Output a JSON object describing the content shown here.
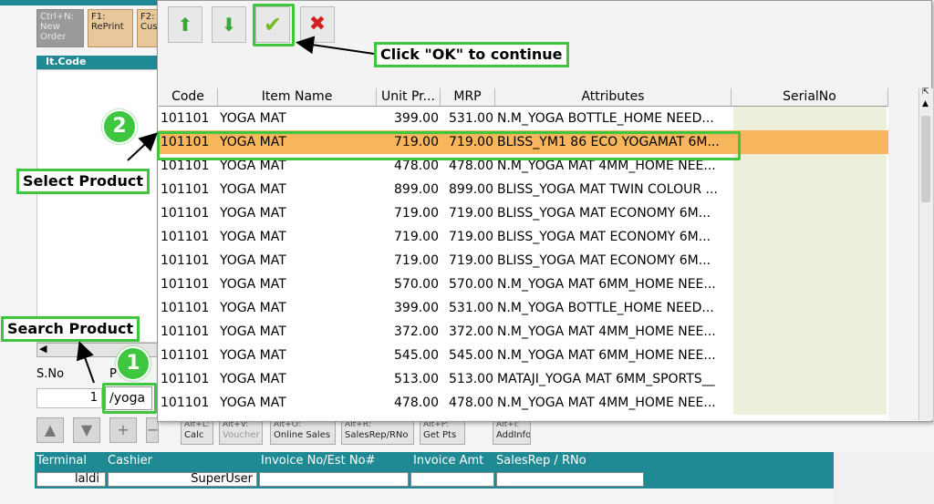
{
  "colors": {
    "teal": "#1f8a94",
    "selected_row": "#f7b55c",
    "annotation": "#3ec63e"
  },
  "background": {
    "fkeys": [
      {
        "key": "Ctrl+N:",
        "label": "New Order"
      },
      {
        "key": "F1:",
        "label": "RePrint"
      },
      {
        "key": "F2:",
        "label": "Cus"
      }
    ],
    "it_code_header": "It.Code",
    "sno_label": "S.No",
    "product_label_partial": "P",
    "sno_value": "1",
    "search_value": "/yoga",
    "bottom_keys": [
      {
        "key": "Alt+L:",
        "label": "Calc"
      },
      {
        "key": "Alt+V:",
        "label": "Voucher"
      },
      {
        "key": "Alt+O:",
        "label": "Online Sales"
      },
      {
        "key": "Alt+R:",
        "label": "SalesRep/RNo"
      },
      {
        "key": "Alt+P:",
        "label": "Get Pts"
      },
      {
        "key": "Alt+I:",
        "label": "AddInfo"
      }
    ],
    "footer_headers": [
      "Terminal",
      "Cashier",
      "Invoice No/Est No#",
      "Invoice Amt",
      "SalesRep / RNo"
    ],
    "footer_values": {
      "terminal": "laldi",
      "cashier": "SuperUser"
    }
  },
  "popup": {
    "toolbar": [
      {
        "icon": "arrow-up-icon"
      },
      {
        "icon": "arrow-down-icon"
      },
      {
        "icon": "checkmark-icon"
      },
      {
        "icon": "close-icon"
      }
    ],
    "columns": [
      "Code",
      "Item Name",
      "Unit Pr...",
      "MRP",
      "Attributes",
      "SerialNo"
    ],
    "rows": [
      {
        "code": "101101",
        "name": "YOGA MAT",
        "unit": "399.00",
        "mrp": "531.00",
        "attr": "N.M_YOGA BOTTLE_HOME NEED...",
        "serial": ""
      },
      {
        "code": "101101",
        "name": "YOGA MAT",
        "unit": "719.00",
        "mrp": "719.00",
        "attr": "BLISS_YM1 86 ECO YOGAMAT 6M...",
        "serial": ""
      },
      {
        "code": "101101",
        "name": "YOGA MAT",
        "unit": "478.00",
        "mrp": "478.00",
        "attr": "N.M_YOGA MAT 4MM_HOME NEE...",
        "serial": ""
      },
      {
        "code": "101101",
        "name": "YOGA MAT",
        "unit": "899.00",
        "mrp": "899.00",
        "attr": "BLISS_YOGA MAT TWIN COLOUR ...",
        "serial": ""
      },
      {
        "code": "101101",
        "name": "YOGA MAT",
        "unit": "719.00",
        "mrp": "719.00",
        "attr": "BLISS_YOGA MAT ECONOMY 6M...",
        "serial": ""
      },
      {
        "code": "101101",
        "name": "YOGA MAT",
        "unit": "719.00",
        "mrp": "719.00",
        "attr": "BLISS_YOGA MAT ECONOMY 6M...",
        "serial": ""
      },
      {
        "code": "101101",
        "name": "YOGA MAT",
        "unit": "719.00",
        "mrp": "719.00",
        "attr": "BLISS_YOGA MAT ECONOMY 6M...",
        "serial": ""
      },
      {
        "code": "101101",
        "name": "YOGA MAT",
        "unit": "570.00",
        "mrp": "570.00",
        "attr": "N.M_YOGA MAT 6MM_HOME NEE...",
        "serial": ""
      },
      {
        "code": "101101",
        "name": "YOGA MAT",
        "unit": "399.00",
        "mrp": "531.00",
        "attr": "N.M_YOGA BOTTLE_HOME NEED...",
        "serial": ""
      },
      {
        "code": "101101",
        "name": "YOGA MAT",
        "unit": "372.00",
        "mrp": "372.00",
        "attr": "N.M_YOGA MAT 4MM_HOME NEE...",
        "serial": ""
      },
      {
        "code": "101101",
        "name": "YOGA MAT",
        "unit": "545.00",
        "mrp": "545.00",
        "attr": "N.M_YOGA MAT 6MM_HOME NEE...",
        "serial": ""
      },
      {
        "code": "101101",
        "name": "YOGA MAT",
        "unit": "513.00",
        "mrp": "513.00",
        "attr": "MATAJI_YOGA MAT 6MM_SPORTS__",
        "serial": ""
      },
      {
        "code": "101101",
        "name": "YOGA MAT",
        "unit": "478.00",
        "mrp": "478.00",
        "attr": "N.M_YOGA MAT 4MM_HOME NEE...",
        "serial": ""
      }
    ],
    "selected_index": 1
  },
  "annotations": {
    "click_ok": "Click \"OK\" to continue",
    "select_product": "Select Product",
    "search_product": "Search Product",
    "step1": "1",
    "step2": "2"
  }
}
